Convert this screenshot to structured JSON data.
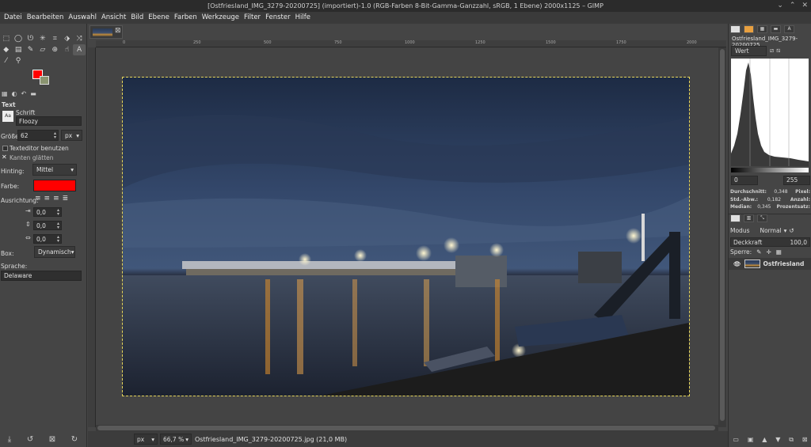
{
  "window": {
    "title": "[Ostfriesland_IMG_3279-20200725] (importiert)-1.0 (RGB-Farben 8-Bit-Gamma-Ganzzahl, sRGB, 1 Ebene) 2000x1125 – GIMP",
    "controls": [
      "⌄",
      "⌃",
      "✕"
    ]
  },
  "menubar": [
    "Datei",
    "Bearbeiten",
    "Auswahl",
    "Ansicht",
    "Bild",
    "Ebene",
    "Farben",
    "Werkzeuge",
    "Filter",
    "Fenster",
    "Hilfe"
  ],
  "toolbox": {
    "tools": [
      "rect-select",
      "ellipse-select",
      "free-select",
      "fuzzy-select",
      "crop",
      "unified-transform",
      "warp",
      "fill",
      "gradient",
      "pencil",
      "eraser",
      "clone",
      "smudge",
      "text",
      "color-picker",
      "zoom"
    ],
    "section_title": "Text",
    "font_label": "Schrift",
    "font_value": "Floozy",
    "size_label": "Größe:",
    "size_value": "62",
    "size_unit": "px",
    "use_editor_label": "Texteditor benutzen",
    "antialias_label": "Kanten glätten",
    "hinting_label": "Hinting:",
    "hinting_value": "Mittel",
    "color_label": "Farbe:",
    "text_color": "#ff0000",
    "justify_label": "Ausrichtung:",
    "indent_value": "0,0",
    "line_spacing_value": "0,0",
    "letter_spacing_value": "0,0",
    "box_label": "Box:",
    "box_value": "Dynamisch",
    "language_label": "Sprache:",
    "language_value": "Delaware"
  },
  "canvas": {
    "ruler_ticks": [
      "0",
      "250",
      "500",
      "750",
      "1000",
      "1250",
      "1500",
      "1750",
      "2000"
    ],
    "unit": "px",
    "zoom": "66,7 %",
    "file_info": "Ostfriesland_IMG_3279-20200725.jpg (21,0 MB)"
  },
  "histogram": {
    "title": "Ostfriesland_IMG_3279-20200725...",
    "channel": "Wert",
    "range_low": "0",
    "range_high": "255",
    "stats": [
      {
        "label": "Durchschnitt:",
        "value": "0,348",
        "label2": "Pixel:"
      },
      {
        "label": "Std.-Abw.:",
        "value": "0,182",
        "label2": "Anzahl:"
      },
      {
        "label": "Median:",
        "value": "0,345",
        "label2": "Prozentsatz:"
      }
    ]
  },
  "layers": {
    "mode_label": "Modus",
    "mode_value": "Normal",
    "opacity_label": "Deckkraft",
    "opacity_value": "100,0",
    "lock_label": "Sperre:",
    "layer_name": "Ostfriesland"
  }
}
